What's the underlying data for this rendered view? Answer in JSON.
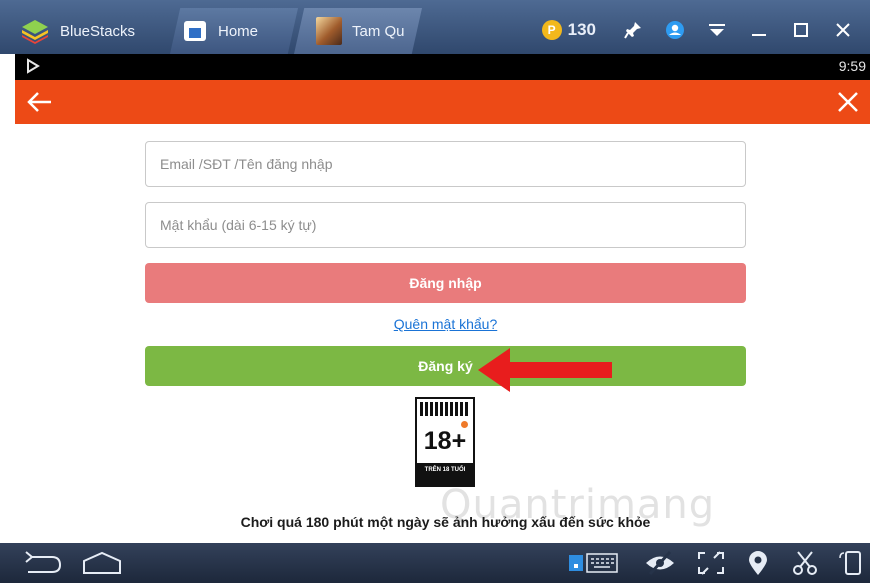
{
  "window": {
    "app_name": "BlueStacks",
    "tabs": [
      {
        "label": "Home"
      },
      {
        "label": "Tam Qu"
      }
    ],
    "coins": "130",
    "coin_symbol": "P"
  },
  "status_bar": {
    "time": "9:59"
  },
  "login": {
    "email_placeholder": "Email /SĐT /Tên đăng nhập",
    "email_value": "",
    "password_placeholder": "Mật khẩu (dài 6-15 ký tự)",
    "password_value": "",
    "login_button": "Đăng nhập",
    "forgot_link": "Quên mật khẩu?",
    "register_button": "Đăng ký"
  },
  "age_rating": {
    "age": "18+",
    "note": "TRÊN 18 TUỔI"
  },
  "warning_text": "Chơi quá 180 phút một ngày sẽ ảnh hưởng xấu đến sức khỏe",
  "watermark": "Quantrimang",
  "colors": {
    "app_header": "#ed4a16",
    "login_button": "#e97b7c",
    "register_button": "#7cb844",
    "link": "#1a73d6",
    "arrow": "#e81d1d"
  }
}
